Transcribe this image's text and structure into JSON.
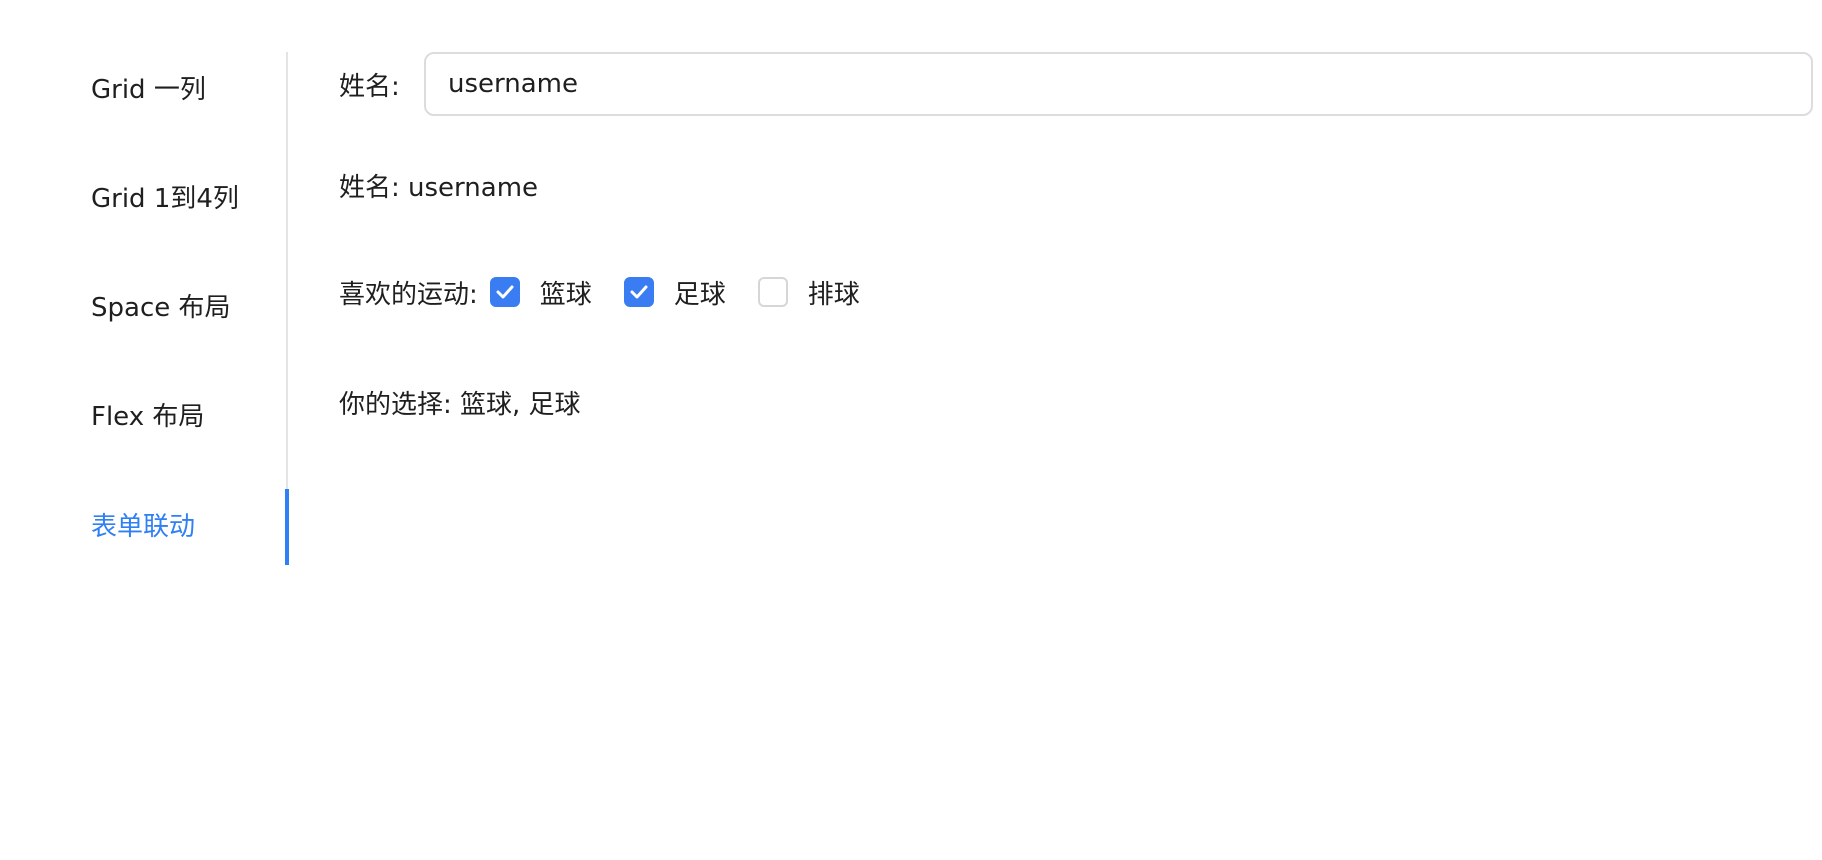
{
  "sidebar": {
    "items": [
      {
        "label": "Grid 一列",
        "active": false
      },
      {
        "label": "Grid 1到4列",
        "active": false
      },
      {
        "label": "Space 布局",
        "active": false
      },
      {
        "label": "Flex 布局",
        "active": false
      },
      {
        "label": "表单联动",
        "active": true
      }
    ]
  },
  "form": {
    "name_label": "姓名:",
    "name_value": "username",
    "name_preview": "姓名: username",
    "sports_label": "喜欢的运动:",
    "sports_options": [
      {
        "label": "篮球",
        "checked": true
      },
      {
        "label": "足球",
        "checked": true
      },
      {
        "label": "排球",
        "checked": false
      }
    ],
    "choice_text": "你的选择: 篮球, 足球"
  },
  "colors": {
    "accent": "#2f7ff5",
    "checkbox_checked": "#3a7cf2",
    "text": "#1f1f1f",
    "border": "#dcdcdc"
  }
}
